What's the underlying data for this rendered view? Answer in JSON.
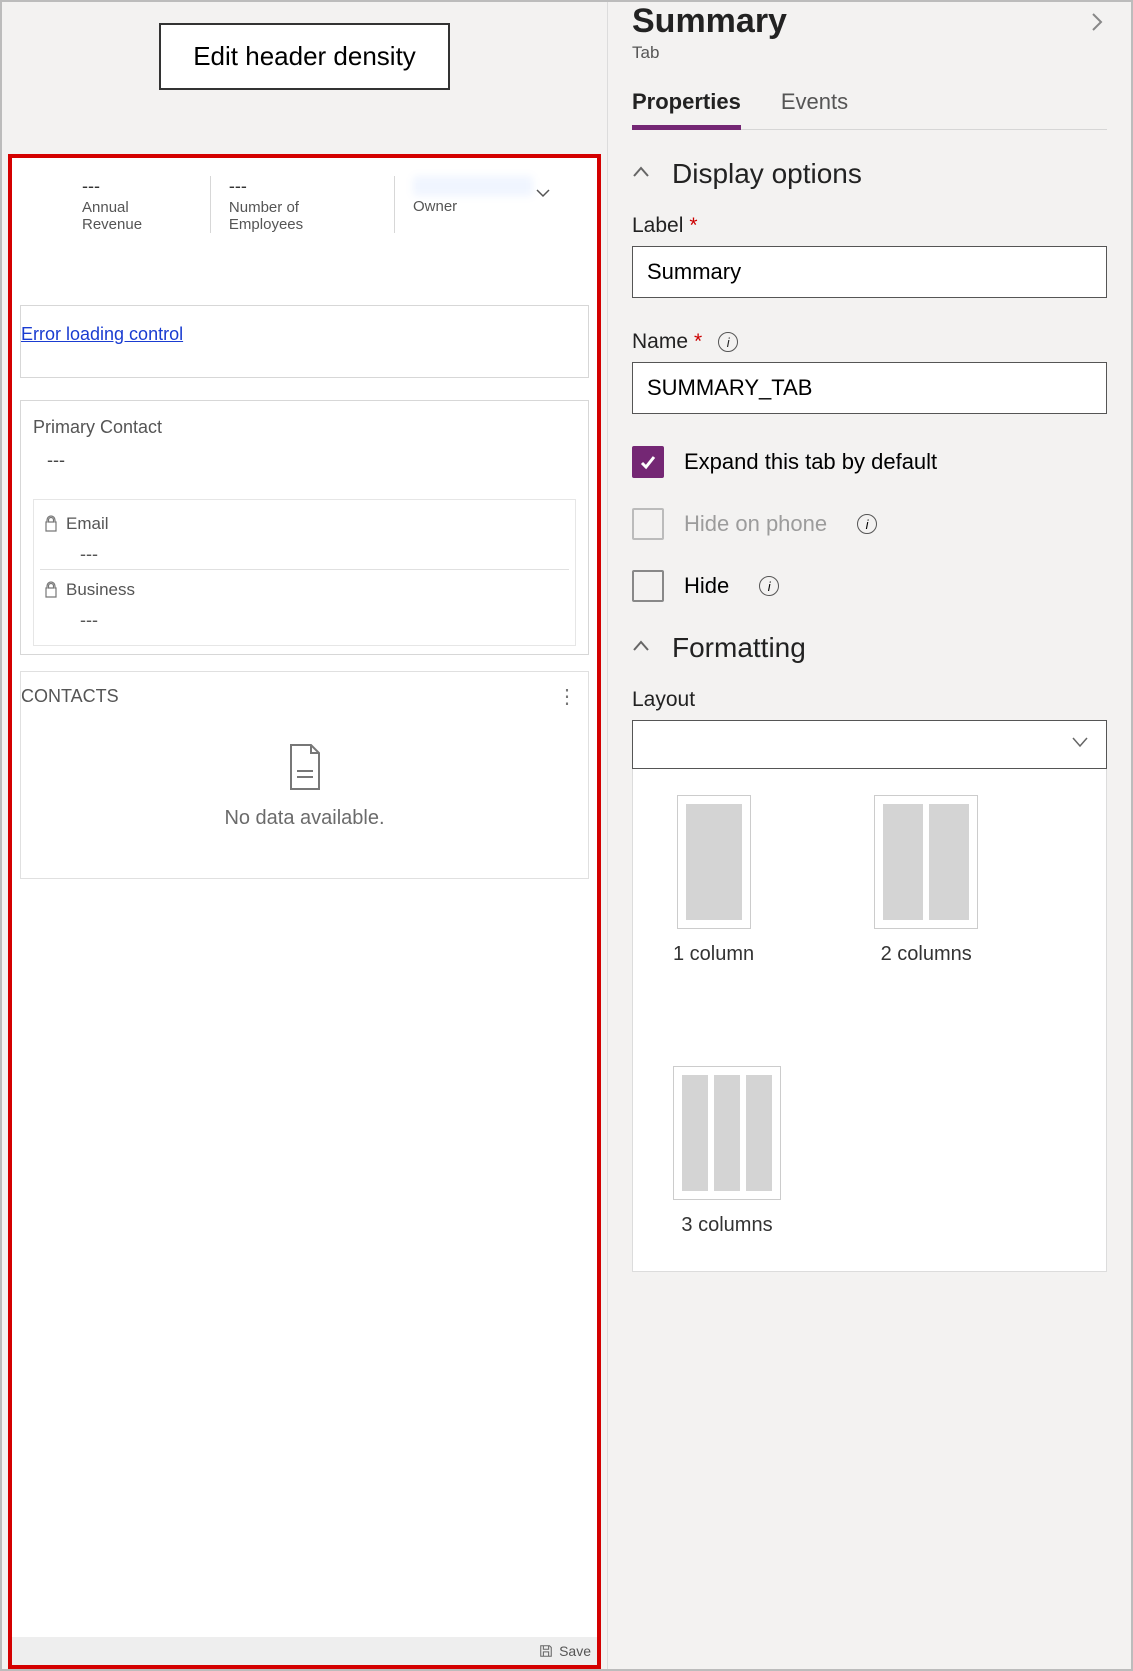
{
  "toolbar": {
    "edit_button": "Edit header density"
  },
  "preview": {
    "header_fields": [
      {
        "value": "---",
        "label": "Annual Revenue"
      },
      {
        "value": "---",
        "label": "Number of Employees"
      },
      {
        "value": "",
        "label": "Owner"
      }
    ],
    "error_text": "Error loading control",
    "primary_contact": {
      "label": "Primary Contact",
      "value": "---"
    },
    "fields": [
      {
        "label": "Email",
        "value": "---"
      },
      {
        "label": "Business",
        "value": "---"
      }
    ],
    "contacts_section_title": "CONTACTS",
    "no_data_text": "No data available.",
    "save_label": "Save"
  },
  "panel": {
    "title": "Summary",
    "subtitle": "Tab",
    "tabs": {
      "properties": "Properties",
      "events": "Events"
    },
    "groups": {
      "display": "Display options",
      "formatting": "Formatting"
    },
    "label_field": {
      "label": "Label",
      "value": "Summary"
    },
    "name_field": {
      "label": "Name",
      "value": "SUMMARY_TAB"
    },
    "checks": {
      "expand": "Expand this tab by default",
      "hide_phone": "Hide on phone",
      "hide": "Hide"
    },
    "layout_label": "Layout",
    "layout_options": {
      "c1": "1 column",
      "c2": "2 columns",
      "c3": "3 columns"
    }
  }
}
